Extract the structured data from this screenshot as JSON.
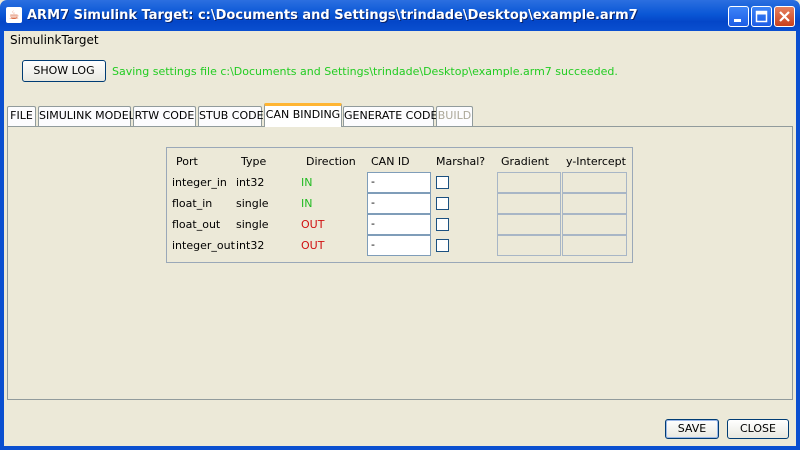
{
  "window": {
    "title": "ARM7 Simulink Target: c:\\Documents and Settings\\trindade\\Desktop\\example.arm7",
    "icon": "java-cup-icon"
  },
  "menu": {
    "items": [
      "SimulinkTarget"
    ]
  },
  "toolbar": {
    "show_log_label": "SHOW LOG",
    "status_message": "Saving settings file c:\\Documents and Settings\\trindade\\Desktop\\example.arm7 succeeded.",
    "status_color": "#22cc22"
  },
  "tabs": [
    {
      "label": "FILE",
      "active": false,
      "enabled": true
    },
    {
      "label": "SIMULINK MODEL",
      "active": false,
      "enabled": true
    },
    {
      "label": "RTW CODE",
      "active": false,
      "enabled": true
    },
    {
      "label": "STUB CODE",
      "active": false,
      "enabled": true
    },
    {
      "label": "CAN BINDING",
      "active": true,
      "enabled": true
    },
    {
      "label": "GENERATE CODE",
      "active": false,
      "enabled": true
    },
    {
      "label": "BUILD",
      "active": false,
      "enabled": false
    }
  ],
  "binding_table": {
    "headers": [
      "Port",
      "Type",
      "Direction",
      "CAN ID",
      "Marshal?",
      "Gradient",
      "y-Intercept"
    ],
    "rows": [
      {
        "port": "integer_in",
        "type": "int32",
        "direction": "IN",
        "can_id": "-",
        "marshal": false
      },
      {
        "port": "float_in",
        "type": "single",
        "direction": "IN",
        "can_id": "-",
        "marshal": false
      },
      {
        "port": "float_out",
        "type": "single",
        "direction": "OUT",
        "can_id": "-",
        "marshal": false
      },
      {
        "port": "integer_out",
        "type": "int32",
        "direction": "OUT",
        "can_id": "-",
        "marshal": false
      }
    ],
    "colors": {
      "in": "#22bb22",
      "out": "#d01010"
    }
  },
  "footer": {
    "save_label": "SAVE",
    "close_label": "CLOSE"
  }
}
